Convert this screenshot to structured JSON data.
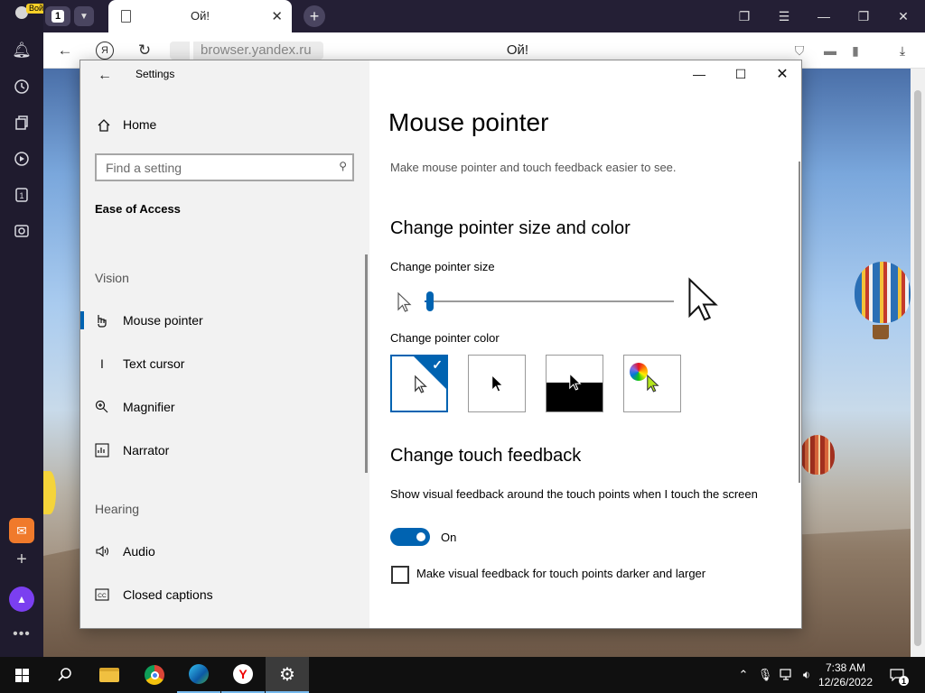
{
  "browser": {
    "login_label": "Войти",
    "tab_count": "1",
    "tab_title": "Ой!",
    "url_host": "browser.yandex.ru",
    "page_title": "Ой!",
    "ya_label": "Я",
    "badge_count": "1"
  },
  "settings": {
    "app_title": "Settings",
    "home_label": "Home",
    "search_placeholder": "Find a setting",
    "section_title": "Ease of Access",
    "groups": {
      "vision": "Vision",
      "hearing": "Hearing"
    },
    "nav_items": [
      {
        "label": "Mouse pointer",
        "icon": "mouse-pointer-icon",
        "active": true
      },
      {
        "label": "Text cursor",
        "icon": "text-cursor-icon",
        "active": false
      },
      {
        "label": "Magnifier",
        "icon": "magnifier-icon",
        "active": false
      },
      {
        "label": "Narrator",
        "icon": "narrator-icon",
        "active": false
      },
      {
        "label": "Audio",
        "icon": "audio-icon",
        "active": false
      },
      {
        "label": "Closed captions",
        "icon": "closed-captions-icon",
        "active": false
      }
    ],
    "content": {
      "title": "Mouse pointer",
      "subtitle": "Make mouse pointer and touch feedback easier to see.",
      "pointer_section": "Change pointer size and color",
      "size_label": "Change pointer size",
      "size_value": 0.02,
      "color_label": "Change pointer color",
      "color_options": [
        "white",
        "black",
        "inverted",
        "custom"
      ],
      "selected_color": "white",
      "touch_section": "Change touch feedback",
      "touch_desc": "Show visual feedback around the touch points when I touch the screen",
      "toggle_state": "On",
      "checkbox_label": "Make visual feedback for touch points darker and larger",
      "checkbox_checked": false
    }
  },
  "taskbar": {
    "time": "7:38 AM",
    "date": "12/26/2022",
    "notification_count": "1",
    "apps": [
      "start",
      "search",
      "file-explorer",
      "chrome",
      "edge",
      "yandex",
      "settings"
    ]
  },
  "colors": {
    "accent": "#0063b1",
    "nav_bg": "#f2f2f2",
    "taskbar_bg": "#101010",
    "browser_side": "#1f1b2e"
  }
}
